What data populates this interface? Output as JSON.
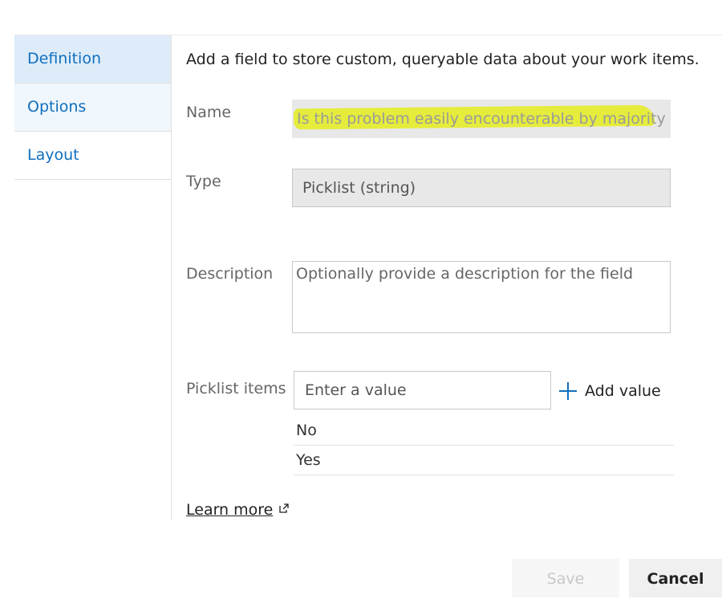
{
  "sidebar": {
    "items": [
      {
        "label": "Definition",
        "state": "selected"
      },
      {
        "label": "Options",
        "state": "hover"
      },
      {
        "label": "Layout",
        "state": "normal"
      }
    ]
  },
  "main": {
    "intro": "Add a field to store custom, queryable data about your work items.",
    "name": {
      "label": "Name",
      "value": "Is this problem easily encounterable by majority"
    },
    "type": {
      "label": "Type",
      "value": "Picklist (string)"
    },
    "description": {
      "label": "Description",
      "placeholder": "Optionally provide a description for the field"
    },
    "picklist": {
      "label": "Picklist items",
      "input_placeholder": "Enter a value",
      "add_label": "Add value",
      "items": [
        "No",
        "Yes"
      ]
    },
    "learn_more": "Learn more"
  },
  "footer": {
    "save_label": "Save",
    "cancel_label": "Cancel"
  },
  "colors": {
    "accent": "#106ebe",
    "highlight": "#e5ec3c",
    "selected_bg": "#deecf9"
  },
  "icons": {
    "add": "plus-icon",
    "external": "external-link-icon"
  }
}
